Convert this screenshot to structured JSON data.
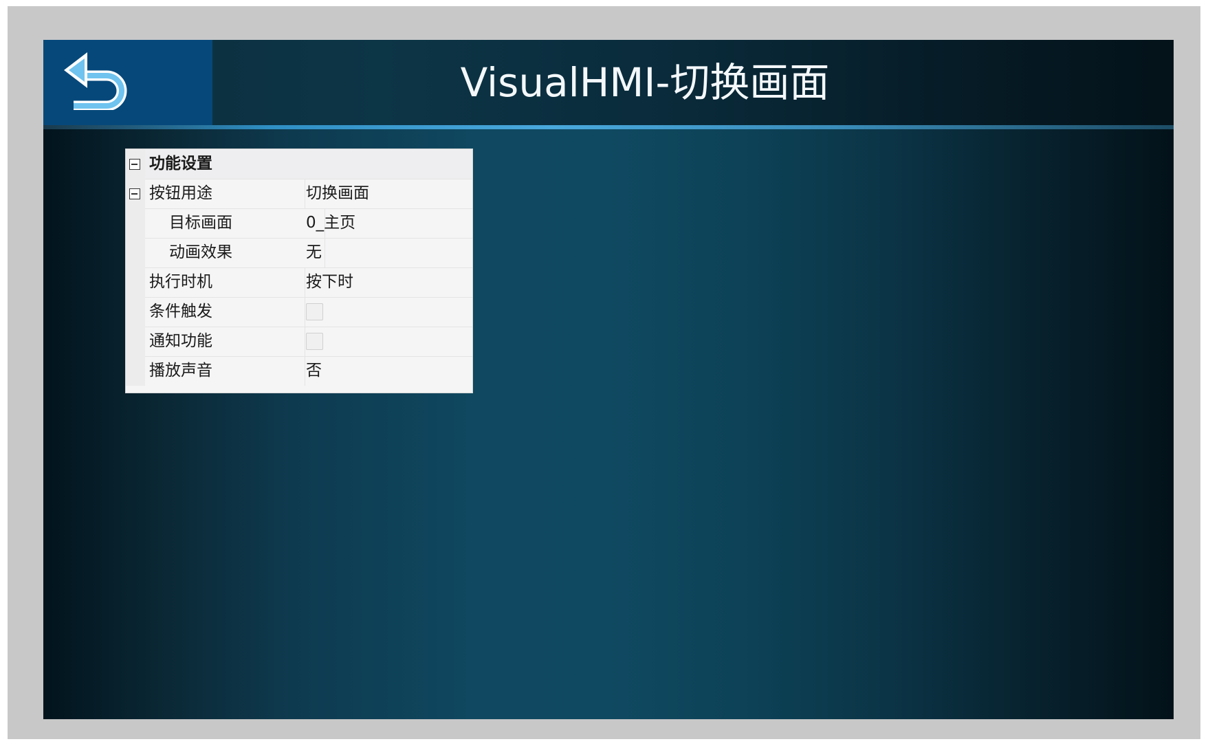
{
  "header": {
    "title": "VisualHMI-切换画面",
    "back_icon": "back-arrow-icon"
  },
  "colors": {
    "back_button_bg": "#06487a",
    "accent_line": "#49a8dc",
    "screen_center": "#0f4961",
    "screen_edge": "#02141d"
  },
  "property_grid": {
    "category": {
      "label": "功能设置",
      "expanded": true
    },
    "rows": [
      {
        "name": "按钮用途",
        "value": "切换画面",
        "expandable": true,
        "expanded": true
      },
      {
        "name": "目标画面",
        "value": "0_主页"
      },
      {
        "name": "动画效果",
        "value": "无"
      },
      {
        "name": "执行时机",
        "value": "按下时"
      },
      {
        "name": "条件触发",
        "checked": false
      },
      {
        "name": "通知功能",
        "checked": false
      },
      {
        "name": "播放声音",
        "value": "否"
      }
    ]
  }
}
